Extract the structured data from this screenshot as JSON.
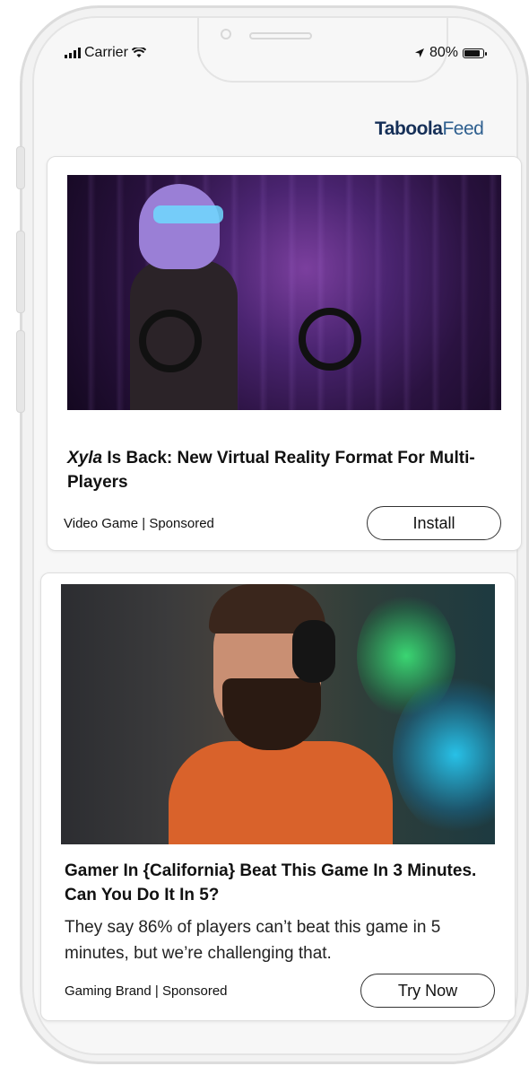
{
  "status_bar": {
    "carrier": "Carrier",
    "battery": "80%",
    "icons": [
      "signal-icon",
      "wifi-icon",
      "location-arrow-icon",
      "battery-icon"
    ]
  },
  "brand": {
    "name": "Taboola",
    "suffix": "Feed",
    "color": "#1b3a5c"
  },
  "cards": [
    {
      "title_italic": "Xyla",
      "title_rest": " Is Back: New Virtual Reality Format For Multi-Players",
      "source": "Video Game | Sponsored",
      "cta": "Install"
    },
    {
      "title": "Gamer In {California} Beat This Game In 3 Minutes. Can You Do It In 5?",
      "description": "They say 86% of players can’t beat this game in 5 minutes, but we’re challenging that.",
      "source": "Gaming Brand | Sponsored",
      "cta": "Try Now"
    }
  ]
}
